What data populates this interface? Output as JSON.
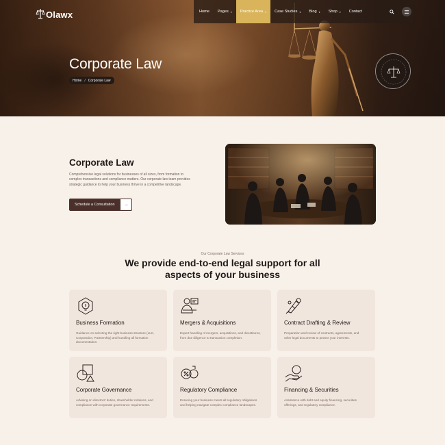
{
  "brand": {
    "name": "Olawx"
  },
  "nav": {
    "items": [
      {
        "label": "Home",
        "caret": ""
      },
      {
        "label": "Pages",
        "caret": "▾"
      },
      {
        "label": "Practice Area",
        "caret": "▾"
      },
      {
        "label": "Case Studies",
        "caret": "▾"
      },
      {
        "label": "Blog",
        "caret": "▾"
      },
      {
        "label": "Shop",
        "caret": "▾"
      },
      {
        "label": "Contact",
        "caret": ""
      }
    ],
    "search_icon": "search-icon",
    "menu_icon": "hamburger-icon"
  },
  "hero": {
    "title": "Corporate Law",
    "breadcrumb": {
      "home": "Home",
      "separator": "/",
      "current": "Corporate Law"
    },
    "badge_text": "Need Any Help ? Contact Us Today +"
  },
  "intro": {
    "title": "Corporate Law",
    "description": "Comprehensive legal solutions for businesses of all sizes, from formation to complex transactions and compliance matters. Our corporate law team provides strategic guidance to help your business thrive in a competitive landscape.",
    "cta_label": "Schedule a Consultation",
    "cta_arrow": "→"
  },
  "services": {
    "eyebrow": "Our Corporate Law Services",
    "title_line1": "We provide end-to-end legal support for all",
    "title_line2": "aspects of your business",
    "cards": [
      {
        "icon": "bulb-icon",
        "title": "Business Formation",
        "desc": "Guidance on selecting the right business structure (LLC, Corporation, Partnership) and handling all formation documentation."
      },
      {
        "icon": "presenter-icon",
        "title": "Mergers & Acquisitions",
        "desc": "Expert handling of mergers, acquisitions, and divestitures, from due diligence to transaction completion."
      },
      {
        "icon": "contract-pen-icon",
        "title": "Contract Drafting & Review",
        "desc": "Preparation and review of contracts, agreements, and other legal documents to protect your interests."
      },
      {
        "icon": "shapes-icon",
        "title": "Corporate Governance",
        "desc": "Advising on directors' duties, shareholder relations, and compliance with corporate governance requirements."
      },
      {
        "icon": "percent-gear-icon",
        "title": "Regulatory Compliance",
        "desc": "Ensuring your business meets all regulatory obligations and helping navigate complex compliance landscapes."
      },
      {
        "icon": "coins-hand-icon",
        "title": "Financing & Securities",
        "desc": "Assistance with debt and equity financing, securities offerings, and regulatory compliance."
      }
    ]
  },
  "colors": {
    "accent": "#d9b45a",
    "dark": "#4a2f2a",
    "card_bg": "#f1e6dd",
    "page_bg": "#f8f1ea"
  }
}
